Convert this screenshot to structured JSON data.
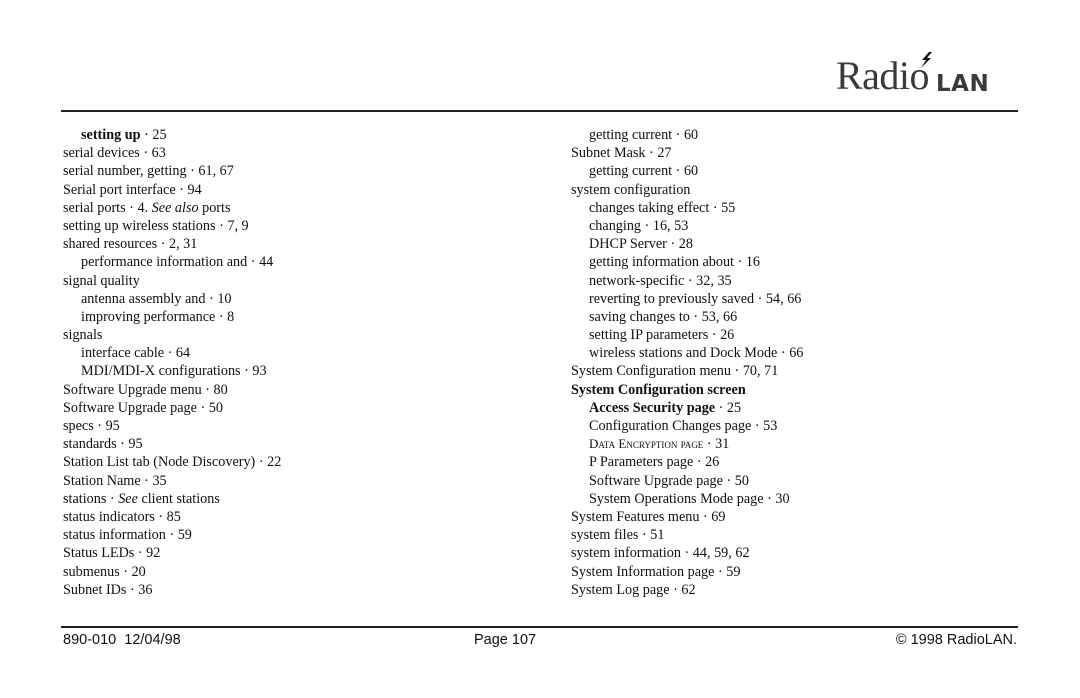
{
  "header": {
    "logo": {
      "radio": "Radio",
      "lan": "LAN",
      "icon": "lightning-bolt-icon"
    }
  },
  "left_column": [
    {
      "term": "setting up",
      "sep": " · ",
      "pages": "25",
      "level": 2,
      "bold": true
    },
    {
      "term": "serial devices",
      "sep": " · ",
      "pages": "63",
      "level": 1
    },
    {
      "term": "serial number, getting",
      "sep": " · ",
      "pages": "61, 67",
      "level": 1
    },
    {
      "term": "Serial port interface",
      "sep": " · ",
      "pages": "94",
      "level": 1
    },
    {
      "term": "serial ports",
      "sep": " · ",
      "pages": "4. ",
      "see": "See also",
      "see_target": " ports",
      "level": 1
    },
    {
      "term": "setting up wireless stations",
      "sep": " · ",
      "pages": "7, 9",
      "level": 1
    },
    {
      "term": "shared resources",
      "sep": " · ",
      "pages": "2, 31",
      "level": 1
    },
    {
      "term": "performance information and",
      "sep": " · ",
      "pages": "44",
      "level": 2
    },
    {
      "term": "signal quality",
      "sep": "",
      "pages": "",
      "level": 1
    },
    {
      "term": "antenna assembly and",
      "sep": " · ",
      "pages": "10",
      "level": 2
    },
    {
      "term": "improving performance",
      "sep": " · ",
      "pages": "8",
      "level": 2
    },
    {
      "term": "signals",
      "sep": "",
      "pages": "",
      "level": 1
    },
    {
      "term": "interface cable",
      "sep": " · ",
      "pages": "64",
      "level": 2
    },
    {
      "term": "MDI/MDI-X configurations",
      "sep": " · ",
      "pages": "93",
      "level": 2
    },
    {
      "term": "Software Upgrade menu",
      "sep": " · ",
      "pages": "80",
      "level": 1
    },
    {
      "term": "Software Upgrade page",
      "sep": " · ",
      "pages": "50",
      "level": 1
    },
    {
      "term": "specs",
      "sep": " · ",
      "pages": "95",
      "level": 1
    },
    {
      "term": "standards",
      "sep": " · ",
      "pages": "95",
      "level": 1
    },
    {
      "term": "Station List tab (Node Discovery)",
      "sep": " · ",
      "pages": "22",
      "level": 1
    },
    {
      "term": "Station Name",
      "sep": " · ",
      "pages": "35",
      "level": 1
    },
    {
      "term": "stations",
      "sep": " · ",
      "pages": "",
      "see": "See",
      "see_target": " client stations",
      "level": 1
    },
    {
      "term": "status indicators",
      "sep": " · ",
      "pages": "85",
      "level": 1
    },
    {
      "term": "status information",
      "sep": " · ",
      "pages": "59",
      "level": 1
    },
    {
      "term": "Status LEDs",
      "sep": " · ",
      "pages": "92",
      "level": 1
    },
    {
      "term": "submenus",
      "sep": " · ",
      "pages": "20",
      "level": 1
    },
    {
      "term": "Subnet IDs",
      "sep": " · ",
      "pages": "36",
      "level": 1
    }
  ],
  "right_column": [
    {
      "term": "getting current",
      "sep": " · ",
      "pages": "60",
      "level": 2
    },
    {
      "term": "Subnet Mask",
      "sep": " · ",
      "pages": "27",
      "level": 1
    },
    {
      "term": "getting current",
      "sep": " · ",
      "pages": "60",
      "level": 2
    },
    {
      "term": "system configuration",
      "sep": "",
      "pages": "",
      "level": 1
    },
    {
      "term": "changes taking effect",
      "sep": " · ",
      "pages": "55",
      "level": 2
    },
    {
      "term": "changing",
      "sep": " · ",
      "pages": "16, 53",
      "level": 2
    },
    {
      "term": "DHCP Server",
      "sep": " · ",
      "pages": "28",
      "level": 2
    },
    {
      "term": "getting information about",
      "sep": " · ",
      "pages": "16",
      "level": 2
    },
    {
      "term": "network-specific",
      "sep": " · ",
      "pages": "32, 35",
      "level": 2
    },
    {
      "term": "reverting to previously saved",
      "sep": " · ",
      "pages": "54, 66",
      "level": 2
    },
    {
      "term": "saving changes to",
      "sep": " · ",
      "pages": "53, 66",
      "level": 2
    },
    {
      "term": "setting IP parameters",
      "sep": " · ",
      "pages": "26",
      "level": 2
    },
    {
      "term": "wireless stations and Dock Mode",
      "sep": " · ",
      "pages": "66",
      "level": 2
    },
    {
      "term": "System Configuration menu",
      "sep": " · ",
      "pages": "70, 71",
      "level": 1
    },
    {
      "term": "System Configuration screen",
      "sep": "",
      "pages": "",
      "level": 1,
      "bold": true
    },
    {
      "term": "Access Security page",
      "sep": " · ",
      "pages": "25",
      "level": 2,
      "bold": true
    },
    {
      "term": "Configuration Changes page",
      "sep": " · ",
      "pages": "53",
      "level": 2
    },
    {
      "term": "Data Encryption page",
      "sep": " · ",
      "pages": "31",
      "level": 2,
      "smallcaps": true
    },
    {
      "term": "P Parameters page",
      "sep": " · ",
      "pages": "26",
      "level": 2
    },
    {
      "term": "Software Upgrade page",
      "sep": " · ",
      "pages": "50",
      "level": 2
    },
    {
      "term": "System Operations Mode page",
      "sep": " · ",
      "pages": "30",
      "level": 2
    },
    {
      "term": "System Features menu",
      "sep": " · ",
      "pages": "69",
      "level": 1
    },
    {
      "term": "system files",
      "sep": " · ",
      "pages": "51",
      "level": 1
    },
    {
      "term": "system information",
      "sep": " · ",
      "pages": "44, 59, 62",
      "level": 1
    },
    {
      "term": "System Information page",
      "sep": " · ",
      "pages": "59",
      "level": 1
    },
    {
      "term": "System Log page",
      "sep": " · ",
      "pages": "62",
      "level": 1
    }
  ],
  "footer": {
    "doc_id": "890-010  12/04/98",
    "page": "Page 107",
    "copyright": "© 1998 RadioLAN."
  }
}
